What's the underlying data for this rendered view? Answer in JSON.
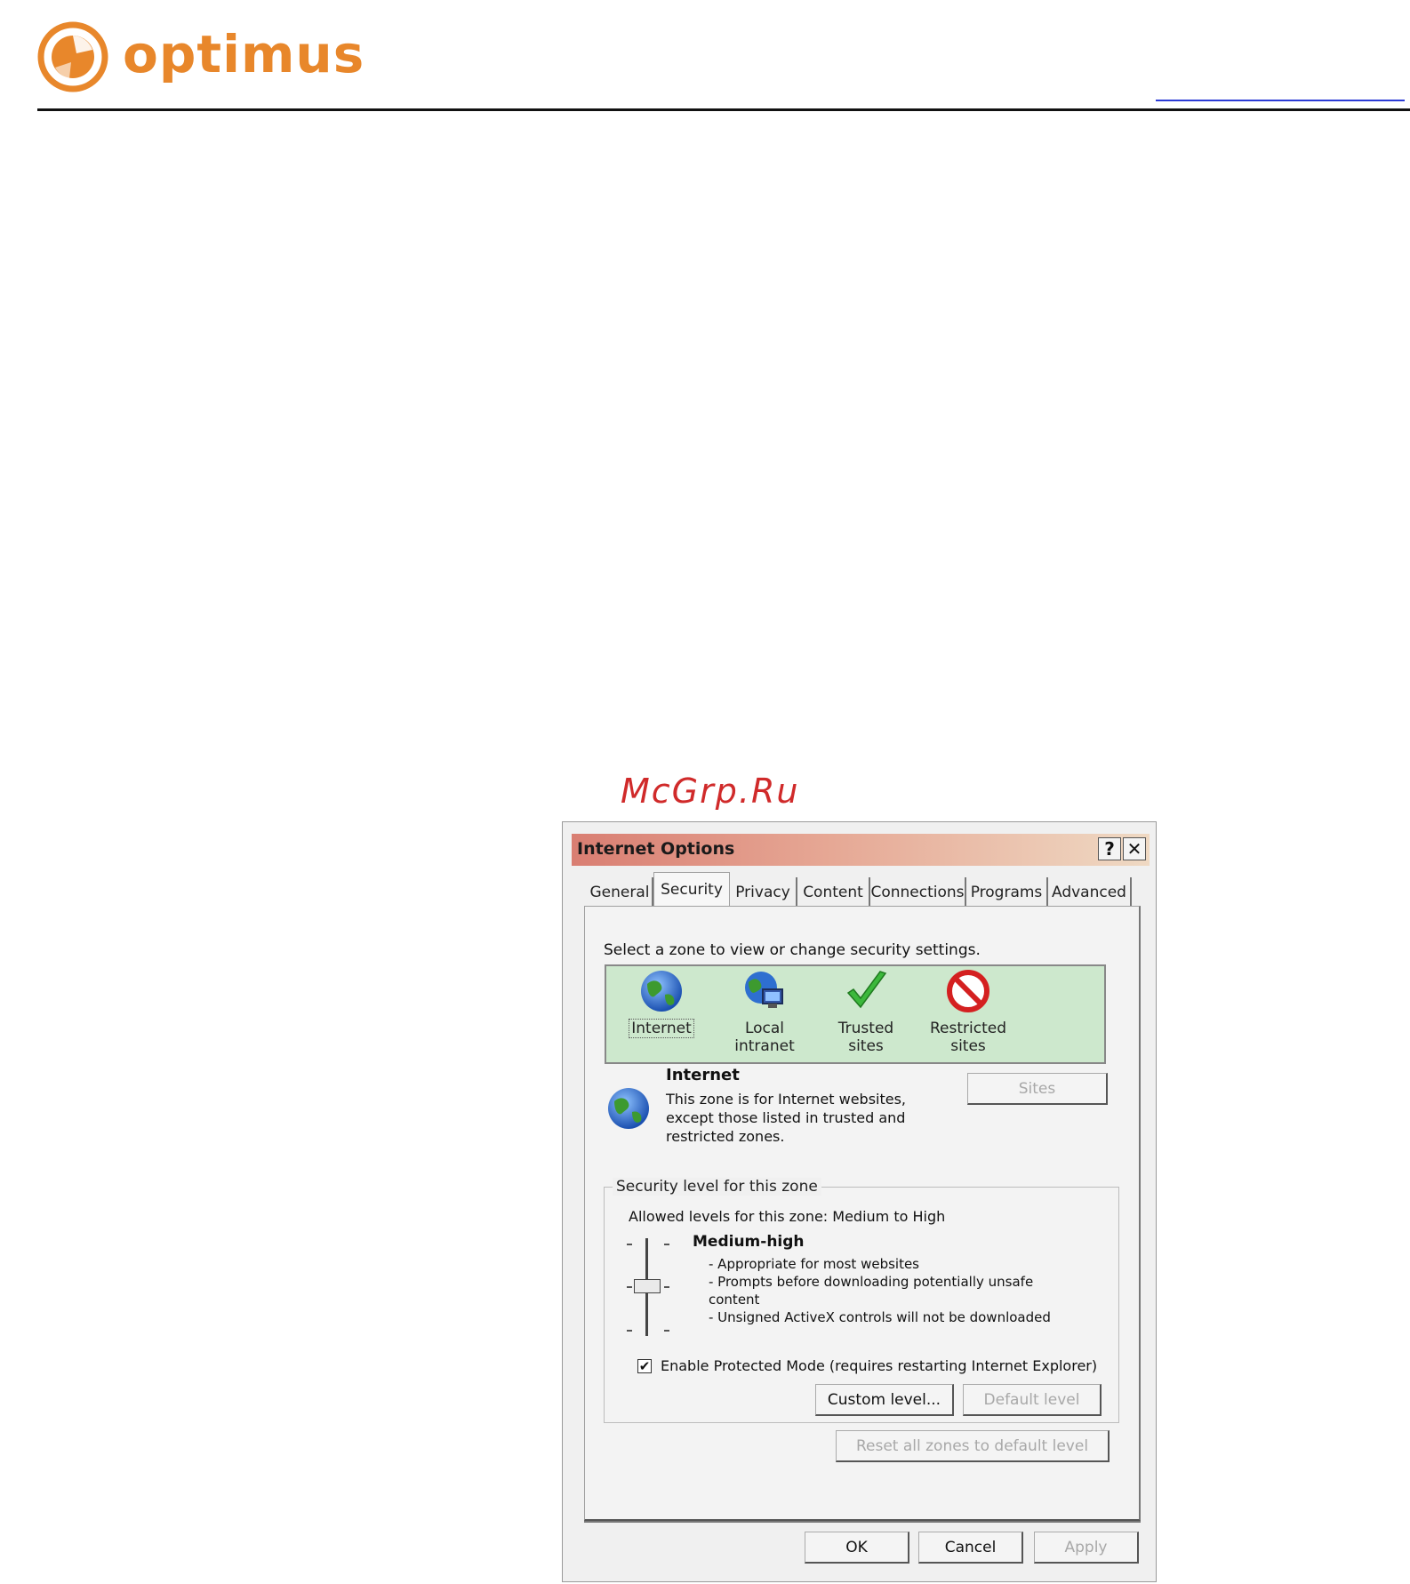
{
  "brand": {
    "name": "optimus",
    "color": "#e8872b"
  },
  "watermark": "McGrp.Ru",
  "dialog": {
    "title": "Internet Options",
    "help_label": "?",
    "close_label": "✕",
    "tabs": [
      "General",
      "Security",
      "Privacy",
      "Content",
      "Connections",
      "Programs",
      "Advanced"
    ],
    "active_tab": "Security",
    "zone_prompt": "Select a zone to view or change security settings.",
    "zones": [
      {
        "label": "Internet",
        "icon": "globe-icon"
      },
      {
        "label": "Local intranet",
        "icon": "intranet-icon"
      },
      {
        "label": "Trusted sites",
        "icon": "checkmark-icon"
      },
      {
        "label": "Restricted sites",
        "label_line1": "Restricted",
        "label_line2": "sites",
        "icon": "prohibited-icon"
      }
    ],
    "selected_zone": {
      "name": "Internet",
      "desc_line1": "This zone is for Internet websites,",
      "desc_line2": "except those listed in trusted and",
      "desc_line3": "restricted zones."
    },
    "sites_button": "Sites",
    "security_group": {
      "legend": "Security level for this zone",
      "allowed_levels": "Allowed levels for this zone: Medium to High",
      "level_name": "Medium-high",
      "level_desc": [
        "- Appropriate for most websites",
        "- Prompts before downloading potentially unsafe",
        "content",
        "- Unsigned ActiveX controls will not be downloaded"
      ],
      "protected_mode_label": "Enable Protected Mode (requires restarting Internet Explorer)",
      "protected_mode_checked": true,
      "check_glyph": "✔",
      "custom_level_button": "Custom level...",
      "default_level_button": "Default level"
    },
    "reset_button": "Reset all zones to default level",
    "footer": {
      "ok": "OK",
      "cancel": "Cancel",
      "apply": "Apply"
    },
    "colors": {
      "zone_bg": "#cde8cd",
      "title_gradient_start": "#d97e72",
      "title_gradient_end": "#efd9c3"
    }
  }
}
